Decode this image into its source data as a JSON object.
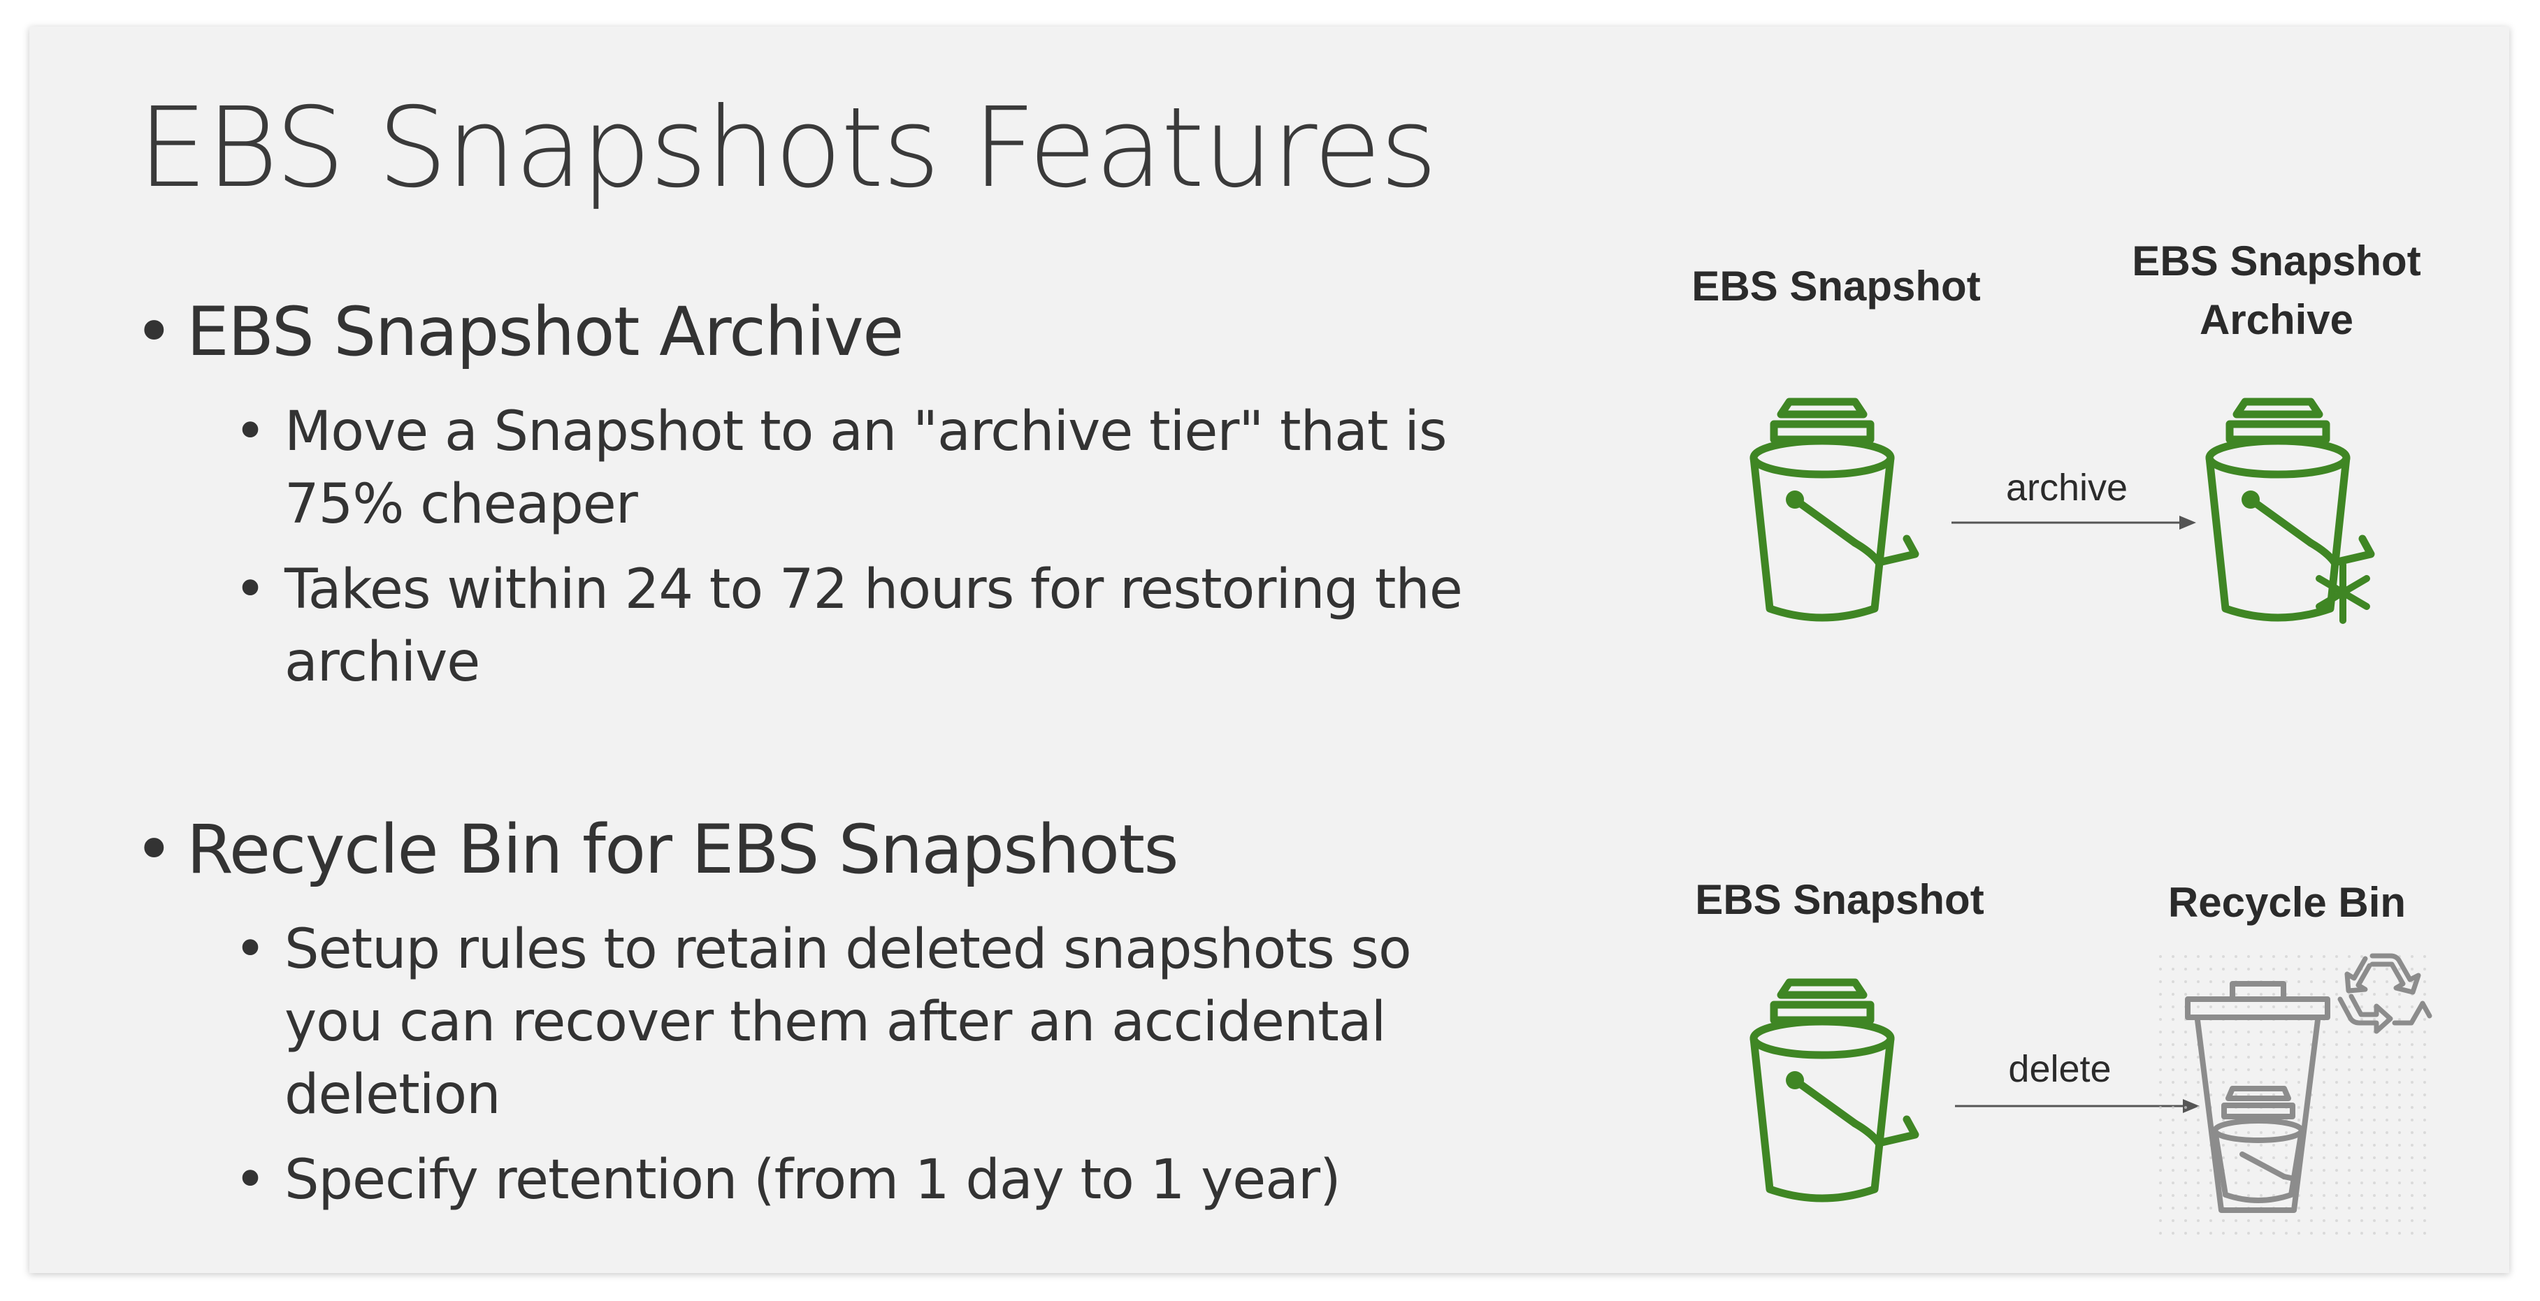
{
  "slide": {
    "title": "EBS Snapshots Features"
  },
  "sections": [
    {
      "heading": "EBS Snapshot Archive",
      "bullets": [
        "Move a Snapshot to an \"archive tier\" that is 75% cheaper",
        "Takes within 24 to 72 hours for restoring the archive"
      ]
    },
    {
      "heading": "Recycle Bin for EBS Snapshots",
      "bullets": [
        "Setup rules to retain deleted snapshots so you can recover them after an accidental deletion",
        "Specify retention (from 1 day to 1 year)"
      ]
    }
  ],
  "diagrams": {
    "archive": {
      "source_label": "EBS Snapshot",
      "target_label": "EBS Snapshot\nArchive",
      "arrow_label": "archive",
      "source_icon": "bucket-icon",
      "target_icon": "archive-bucket-snowflake-icon"
    },
    "recycle": {
      "source_label": "EBS Snapshot",
      "target_label": "Recycle Bin",
      "arrow_label": "delete",
      "source_icon": "bucket-icon",
      "target_icon": "recycle-bin-icon"
    }
  },
  "colors": {
    "icon_green": "#3f8624",
    "icon_gray": "#8c8c8c",
    "text": "#333333",
    "slide_background": "#f2f2f2"
  }
}
